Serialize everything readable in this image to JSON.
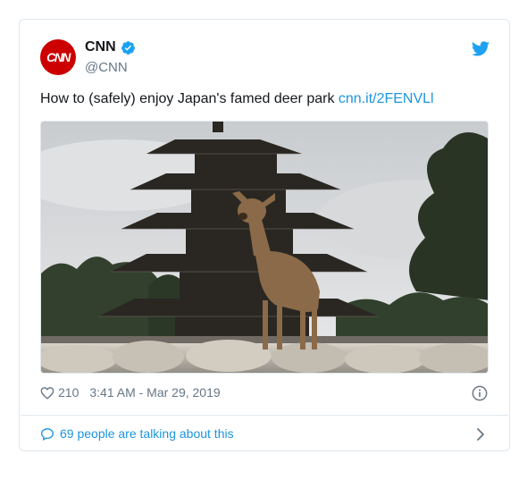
{
  "tweet": {
    "author": {
      "display_name": "CNN",
      "handle": "@CNN",
      "avatar_text": "CNN",
      "verified": true
    },
    "text": "How to (safely) enjoy Japan's famed deer park",
    "link": "cnn.it/2FENVLl",
    "image_alt": "Deer standing on stones in front of a five-story pagoda",
    "likes": "210",
    "timestamp": "3:41 AM - Mar 29, 2019",
    "conversation": "69 people are talking about this"
  },
  "icons": {
    "verified": "verified-badge-icon",
    "bird": "twitter-bird-icon",
    "heart": "heart-icon",
    "info": "info-icon",
    "bubble": "speech-bubble-icon",
    "chevron": "chevron-right-icon"
  },
  "colors": {
    "brand_red": "#cc0000",
    "link_blue": "#1b95e0",
    "muted_gray": "#657786",
    "text_dark": "#14171a",
    "border": "#e1e8ed"
  }
}
